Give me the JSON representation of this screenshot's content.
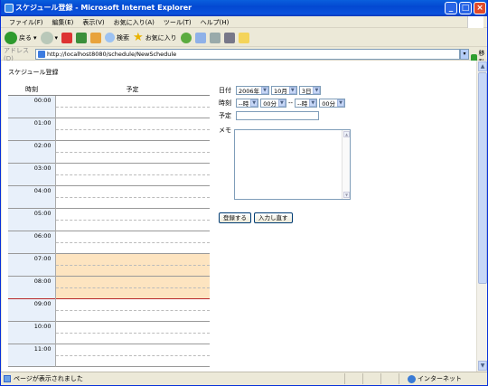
{
  "window": {
    "title": "スケジュール登録 - Microsoft Internet Explorer"
  },
  "menu": [
    "ファイル(F)",
    "編集(E)",
    "表示(V)",
    "お気に入り(A)",
    "ツール(T)",
    "ヘルプ(H)"
  ],
  "toolbar": {
    "back": "戻る",
    "search": "検索",
    "favorites": "お気に入り"
  },
  "address": {
    "label": "アドレス(D)",
    "url": "http://localhost8080/schedule/NewSchedule",
    "go": "移動"
  },
  "page": {
    "title": "スケジュール登録",
    "table": {
      "col_time": "時刻",
      "col_plan": "予定",
      "rows": [
        "00:00",
        "01:00",
        "02:00",
        "03:00",
        "04:00",
        "05:00",
        "06:00",
        "07:00",
        "08:00",
        "09:00",
        "10:00",
        "11:00"
      ],
      "highlighted": [
        "07:00",
        "08:00"
      ]
    },
    "form": {
      "date_label": "日付",
      "year": "2006年",
      "month": "10月",
      "day": "3日",
      "time_label": "時刻",
      "start_hour": "--時",
      "start_min": "00分",
      "sep": "--",
      "end_hour": "--時",
      "end_min": "00分",
      "plan_label": "予定",
      "plan_value": "",
      "memo_label": "メモ",
      "memo_value": "",
      "register_button": "登録する",
      "reset_button": "入力し直す"
    }
  },
  "status": {
    "text": "ページが表示されました",
    "zone": "インターネット"
  },
  "colors": {
    "highlight": "#fde4c0",
    "time_cell": "#e8f0fa",
    "title_bar": "#0348d1"
  }
}
